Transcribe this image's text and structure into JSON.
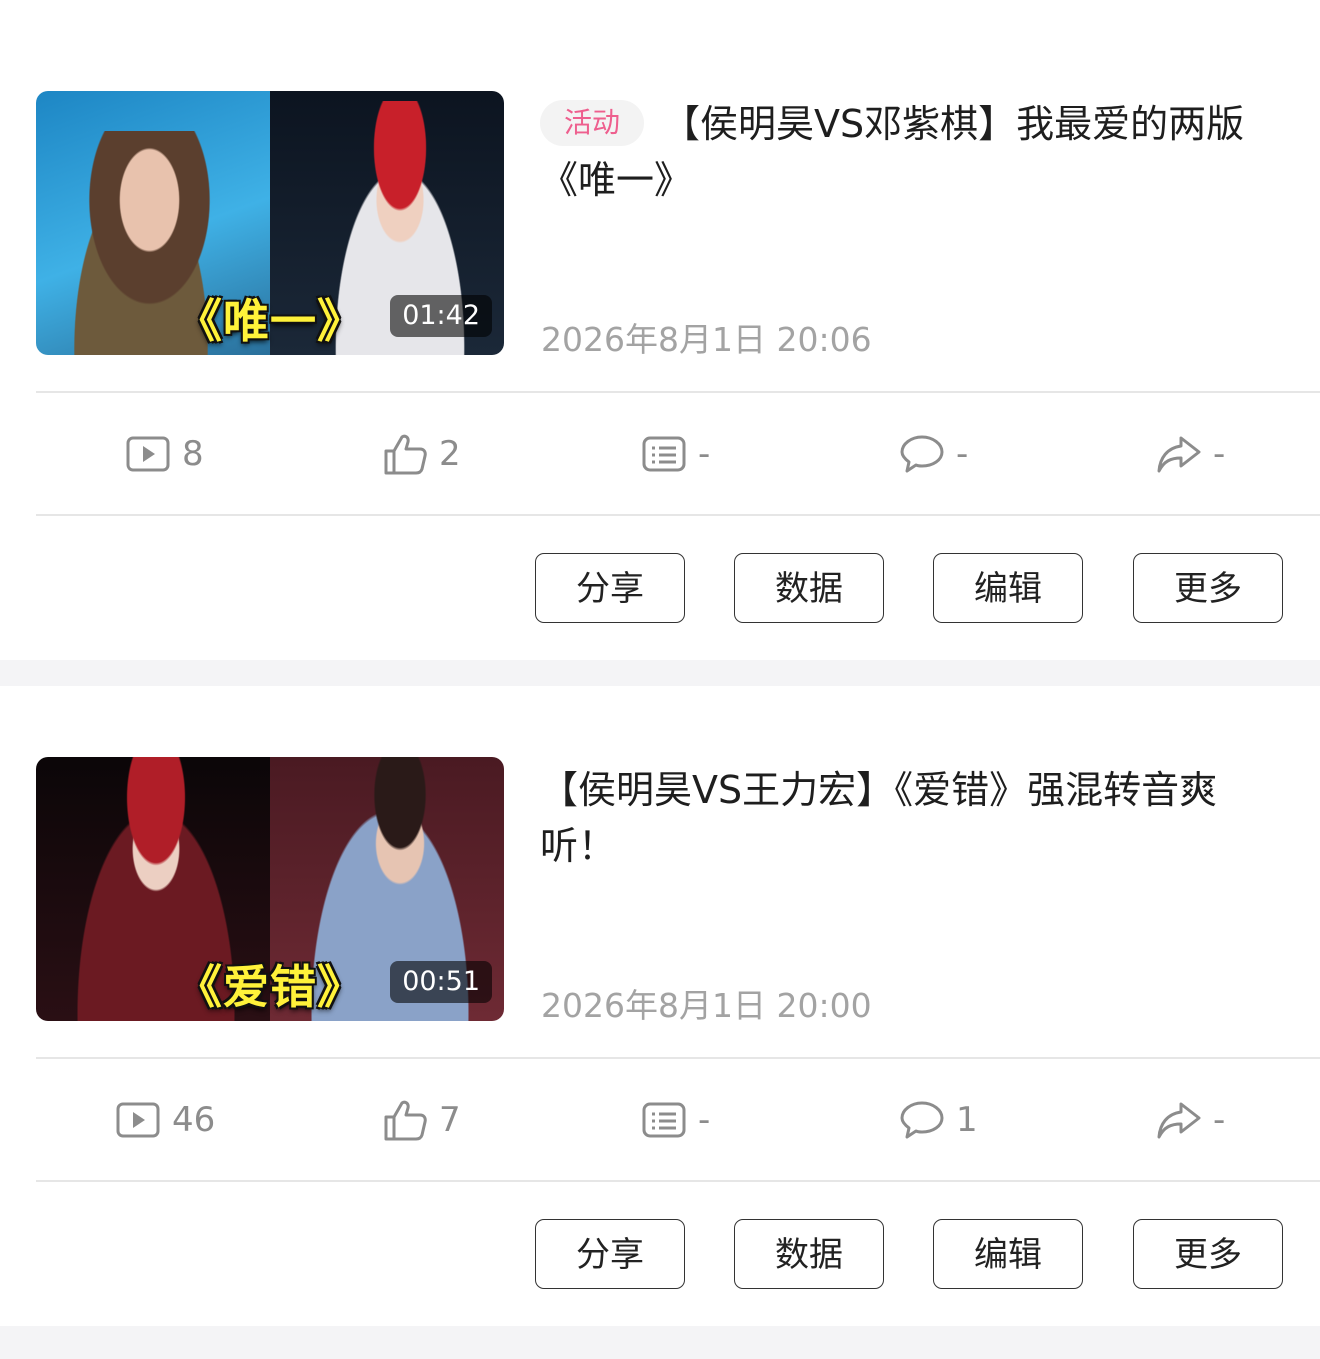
{
  "posts": [
    {
      "tag": "活动",
      "title": "【侯明昊VS邓紫棋】我最爱的两版《唯一》",
      "date": "2026年8月1日 20:06",
      "thumb": {
        "caption": "《唯一》",
        "duration": "01:42",
        "left_bg": "#2aa0d8",
        "right_bg": "#101a28"
      },
      "stats": {
        "plays": "8",
        "likes": "2",
        "danmaku": "-",
        "comments": "-",
        "shares": "-"
      }
    },
    {
      "tag": "",
      "title": "【侯明昊VS王力宏】《爱错》强混转音爽听！",
      "date": "2026年8月1日 20:00",
      "thumb": {
        "caption": "《爱错》",
        "duration": "00:51",
        "left_bg": "#1c0b0d",
        "right_bg": "#5a1f28"
      },
      "stats": {
        "plays": "46",
        "likes": "7",
        "danmaku": "-",
        "comments": "1",
        "shares": "-"
      }
    }
  ],
  "actions": {
    "share": "分享",
    "data": "数据",
    "edit": "编辑",
    "more": "更多"
  },
  "icons": [
    "play-icon",
    "like-icon",
    "danmaku-icon",
    "comment-icon",
    "share-icon"
  ]
}
